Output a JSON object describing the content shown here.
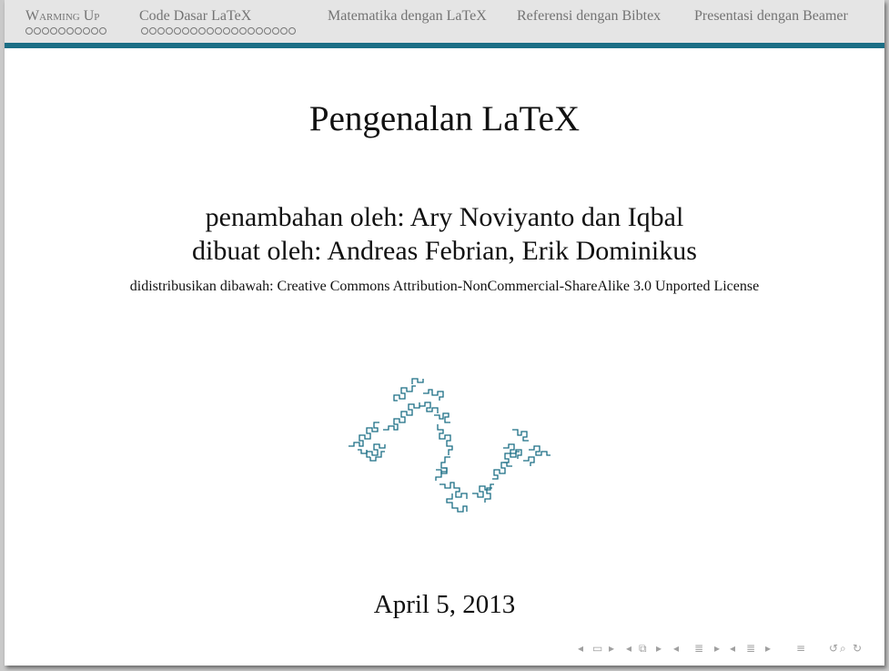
{
  "navbar": {
    "sections": [
      {
        "label_main": "W",
        "label_rest": "arming Up",
        "dots": 10
      },
      {
        "label": "Code Dasar LaTeX",
        "dots": 19
      },
      {
        "label": "Matematika dengan LaTeX"
      },
      {
        "label": "Referensi dengan Bibtex"
      },
      {
        "label": "Presentasi dengan Beamer"
      }
    ]
  },
  "slide": {
    "title": "Pengenalan LaTeX",
    "contributors": "penambahan oleh: Ary Noviyanto dan Iqbal",
    "authors": "dibuat oleh: Andreas Febrian, Erik Dominikus",
    "license": "didistribusikan dibawah: Creative Commons Attribution-NonCommercial-ShareAlike 3.0 Unported License",
    "date": "April 5, 2013",
    "logo_icon": "dragon-curve-fractal",
    "accent_color": "#1b6e85"
  },
  "beamer_controls": {
    "first_icon": "frame-prev-icon",
    "color": "#a0a0a0"
  }
}
